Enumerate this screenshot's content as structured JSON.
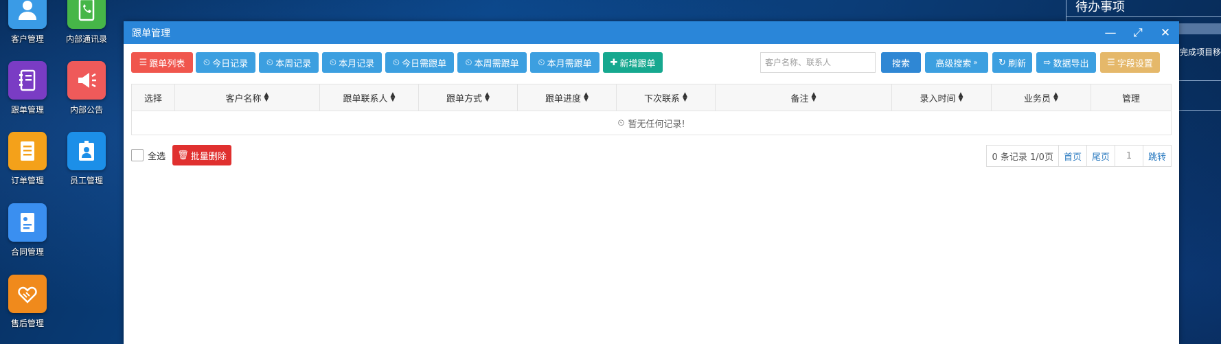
{
  "desktop": {
    "icons": [
      {
        "label": "客户管理",
        "color": "#3a9be6"
      },
      {
        "label": "内部通讯录",
        "color": "#46b648"
      },
      {
        "label": "跟单管理",
        "color": "#7a3cc4"
      },
      {
        "label": "内部公告",
        "color": "#ef5a5a"
      },
      {
        "label": "订单管理",
        "color": "#f4a11a"
      },
      {
        "label": "员工管理",
        "color": "#1c8fe8"
      },
      {
        "label": "合同管理",
        "color": "#3a8ff0"
      },
      {
        "label": "售后管理",
        "color": "#f08a1c"
      }
    ]
  },
  "todo": {
    "title": "待办事项",
    "item": "完成项目移"
  },
  "window": {
    "title": "跟单管理",
    "controls": {
      "minimize": "—",
      "maximize": "⤢",
      "close": "✕"
    }
  },
  "toolbar": {
    "list": "跟单列表",
    "today_record": "今日记录",
    "week_record": "本周记录",
    "month_record": "本月记录",
    "today_need": "今日需跟单",
    "week_need": "本周需跟单",
    "month_need": "本月需跟单",
    "add_new": "新增跟单",
    "search_placeholder": "客户名称、联系人",
    "search": "搜索",
    "advanced": "高级搜索",
    "refresh": "刷新",
    "export": "数据导出",
    "field_settings": "字段设置"
  },
  "table": {
    "columns": [
      "选择",
      "客户名称",
      "跟单联系人",
      "跟单方式",
      "跟单进度",
      "下次联系",
      "备注",
      "录入时间",
      "业务员",
      "管理"
    ],
    "empty_text": "暂无任何记录!"
  },
  "footer": {
    "select_all": "全选",
    "batch_delete": "批量删除"
  },
  "pager": {
    "summary": "0 条记录 1/0页",
    "first": "首页",
    "last": "尾页",
    "page": "1",
    "jump": "跳转"
  },
  "colors": {
    "title_bar": "#2a86d9",
    "red_button": "#f0564d",
    "blue_button": "#3c9fe0",
    "green_button": "#16a88f",
    "gold_button": "#e5b86a",
    "danger_button": "#e0302f"
  }
}
